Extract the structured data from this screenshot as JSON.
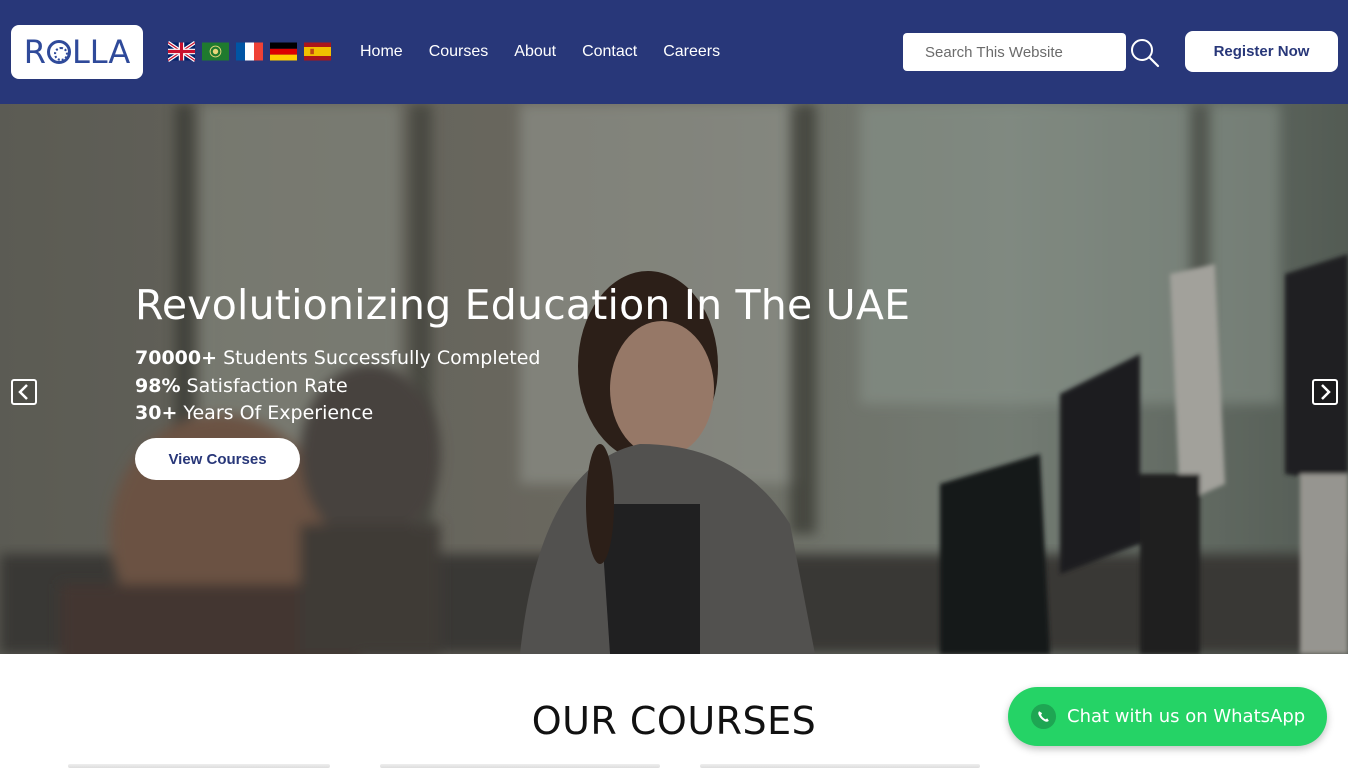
{
  "header": {
    "logo_text_pre": "R",
    "logo_text_post": "LLA",
    "languages": [
      {
        "name": "English",
        "icon": "uk-flag-icon"
      },
      {
        "name": "Arabic",
        "icon": "arabic-flag-icon"
      },
      {
        "name": "French",
        "icon": "france-flag-icon"
      },
      {
        "name": "German",
        "icon": "germany-flag-icon"
      },
      {
        "name": "Spanish",
        "icon": "spain-flag-icon"
      }
    ],
    "nav": [
      "Home",
      "Courses",
      "About",
      "Contact",
      "Careers"
    ],
    "search_placeholder": "Search This Website",
    "register_label": "Register Now",
    "background_color": "#283779"
  },
  "hero": {
    "title": "Revolutionizing Education In The UAE",
    "stats": [
      {
        "value": "70000+",
        "text": " Students Successfully Completed"
      },
      {
        "value": "98%",
        "text": " Satisfaction Rate"
      },
      {
        "value": "30+",
        "text": " Years Of Experience"
      }
    ],
    "cta_label": "View Courses",
    "prev_icon": "chevron-left-icon",
    "next_icon": "chevron-right-icon"
  },
  "courses": {
    "title": "OUR COURSES"
  },
  "whatsapp": {
    "label": "Chat with us on WhatsApp",
    "color": "#25d366"
  }
}
